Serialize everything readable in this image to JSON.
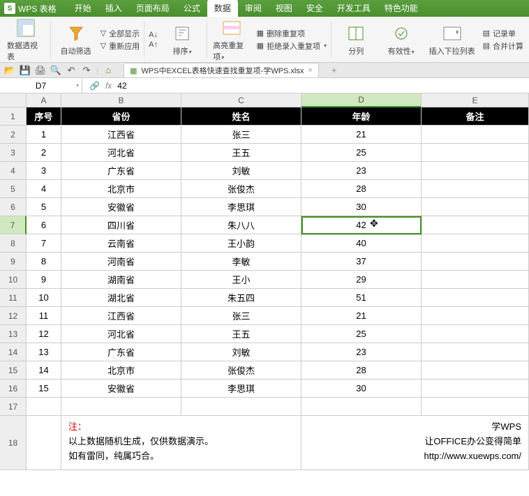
{
  "app": {
    "logo": "S",
    "name": "WPS 表格"
  },
  "menu_tabs": [
    "开始",
    "插入",
    "页面布局",
    "公式",
    "数据",
    "审阅",
    "视图",
    "安全",
    "开发工具",
    "特色功能"
  ],
  "menu_active": 4,
  "ribbon": {
    "pivot": "数据透视表",
    "autofilter": "自动筛选",
    "showall": "全部显示",
    "reapply": "重新应用",
    "sort": "排序",
    "highlight_dup": "高亮重复项",
    "remove_dup": "删除重复项",
    "reject_dup": "拒绝录入重复项",
    "split": "分列",
    "validity": "有效性",
    "insert_dropdown": "插入下拉列表",
    "record": "记录单",
    "consolidate": "合并计算"
  },
  "doc_tab": "WPS中EXCEL表格快速查找重复项-学WPS.xlsx",
  "namebox": "D7",
  "formula": "42",
  "columns": [
    "A",
    "B",
    "C",
    "D",
    "E"
  ],
  "active_col": 3,
  "active_row": 7,
  "headers": [
    "序号",
    "省份",
    "姓名",
    "年龄",
    "备注"
  ],
  "rows": [
    {
      "n": "1",
      "p": "江西省",
      "name": "张三",
      "age": "21",
      "r": ""
    },
    {
      "n": "2",
      "p": "河北省",
      "name": "王五",
      "age": "25",
      "r": ""
    },
    {
      "n": "3",
      "p": "广东省",
      "name": "刘敏",
      "age": "23",
      "r": ""
    },
    {
      "n": "4",
      "p": "北京市",
      "name": "张俊杰",
      "age": "28",
      "r": ""
    },
    {
      "n": "5",
      "p": "安徽省",
      "name": "李思琪",
      "age": "30",
      "r": ""
    },
    {
      "n": "6",
      "p": "四川省",
      "name": "朱八八",
      "age": "42",
      "r": ""
    },
    {
      "n": "7",
      "p": "云南省",
      "name": "王小韵",
      "age": "40",
      "r": ""
    },
    {
      "n": "8",
      "p": "河南省",
      "name": "李敏",
      "age": "37",
      "r": ""
    },
    {
      "n": "9",
      "p": "湖南省",
      "name": "王小",
      "age": "29",
      "r": ""
    },
    {
      "n": "10",
      "p": "湖北省",
      "name": "朱五四",
      "age": "51",
      "r": ""
    },
    {
      "n": "11",
      "p": "江西省",
      "name": "张三",
      "age": "21",
      "r": ""
    },
    {
      "n": "12",
      "p": "河北省",
      "name": "王五",
      "age": "25",
      "r": ""
    },
    {
      "n": "13",
      "p": "广东省",
      "name": "刘敏",
      "age": "23",
      "r": ""
    },
    {
      "n": "14",
      "p": "北京市",
      "name": "张俊杰",
      "age": "28",
      "r": ""
    },
    {
      "n": "15",
      "p": "安徽省",
      "name": "李思琪",
      "age": "30",
      "r": ""
    }
  ],
  "note": {
    "title": "注：",
    "line1": "以上数据随机生成，仅供数据演示。",
    "line2": "如有雷同，纯属巧合。",
    "r1": "学WPS",
    "r2": "让OFFICE办公变得简单",
    "r3": "http://www.xuewps.com/"
  }
}
